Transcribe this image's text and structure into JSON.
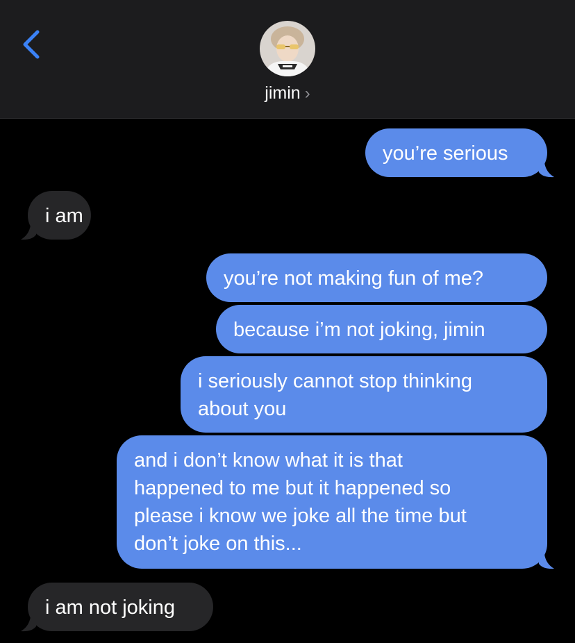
{
  "header": {
    "contact_name": "jimin",
    "chevron": "›"
  },
  "messages": [
    {
      "side": "sent",
      "lines": [
        "you’re serious"
      ]
    },
    {
      "side": "received",
      "lines": [
        "i am"
      ]
    },
    {
      "side": "sent",
      "lines": [
        "you’re not making fun of me?"
      ]
    },
    {
      "side": "sent",
      "lines": [
        "because i’m not joking, jimin"
      ]
    },
    {
      "side": "sent",
      "lines": [
        "i seriously cannot stop thinking",
        "about you"
      ]
    },
    {
      "side": "sent",
      "lines": [
        "and i don’t know what it is that",
        "happened to me but it happened so",
        "please i know we joke all the time but",
        "don’t joke on this..."
      ]
    },
    {
      "side": "received",
      "lines": [
        "i am not joking"
      ]
    }
  ],
  "colors": {
    "sent_bubble": "#5b8bea",
    "received_bubble": "#262628",
    "header_bg": "#1c1c1e",
    "back_arrow": "#3b82f6"
  },
  "icons": {
    "back": "chevron-left-icon",
    "avatar": "contact-avatar"
  }
}
